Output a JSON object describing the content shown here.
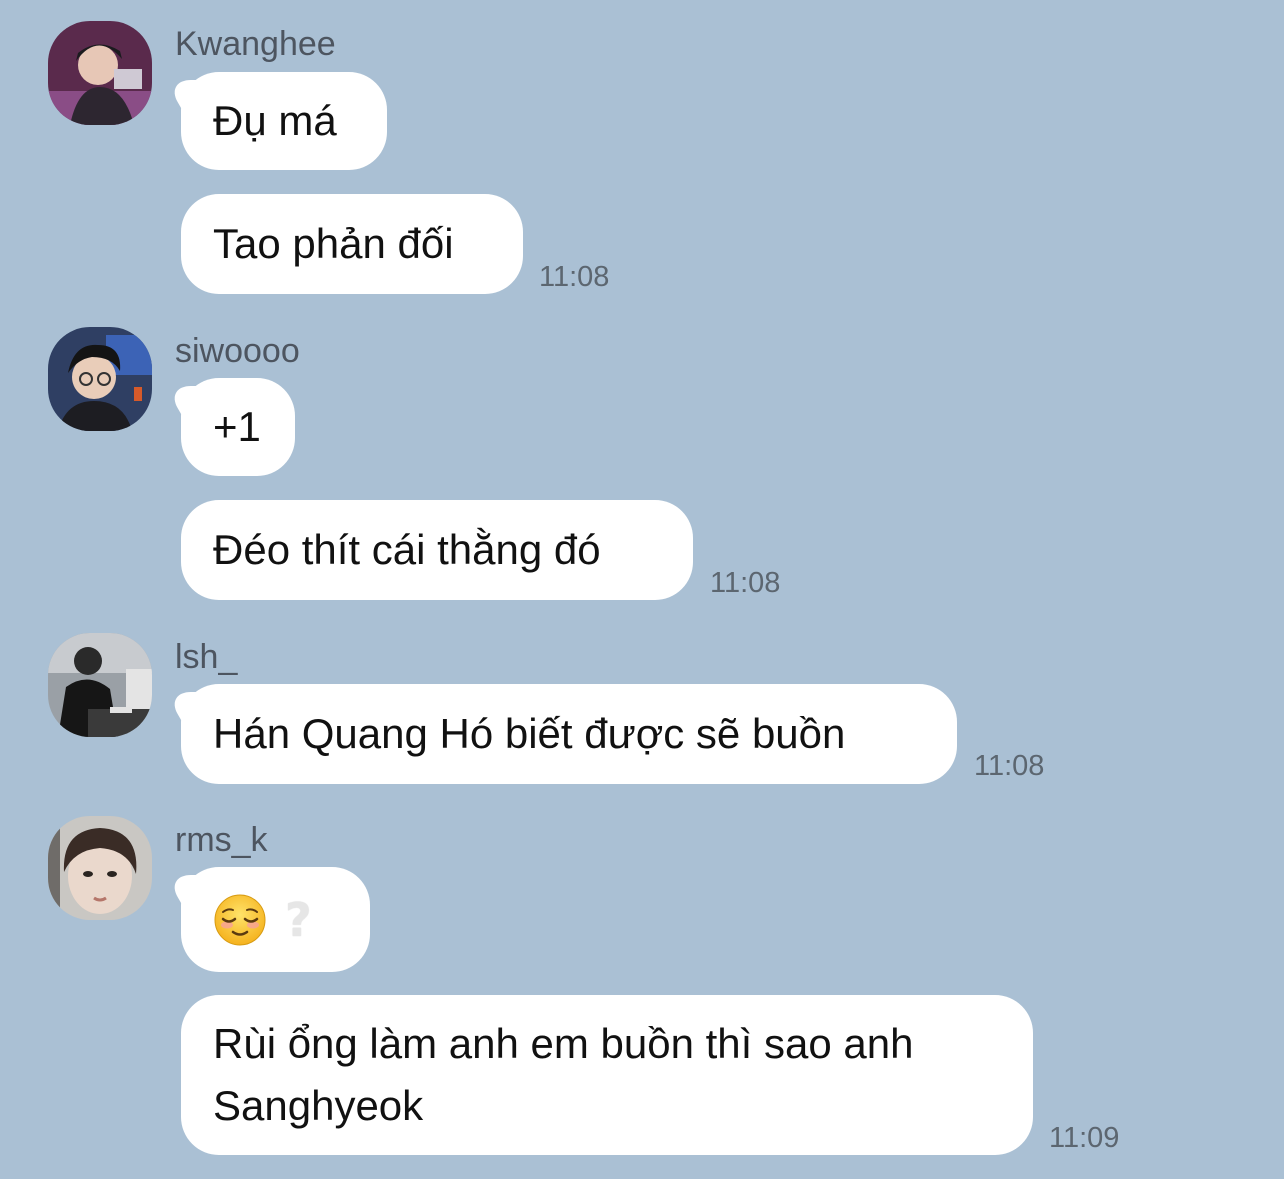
{
  "messages": [
    {
      "sender": "Kwanghee",
      "avatar_icon": "user-avatar-kwanghee",
      "bubbles": [
        "Đụ má",
        "Tao phản đối"
      ],
      "time": "11:08"
    },
    {
      "sender": "siwoooo",
      "avatar_icon": "user-avatar-siwoooo",
      "bubbles": [
        "+1",
        "Đéo thít cái thằng đó"
      ],
      "time": "11:08"
    },
    {
      "sender": "lsh_",
      "avatar_icon": "user-avatar-lsh",
      "bubbles": [
        "Hán Quang Hó biết được sẽ buồn"
      ],
      "time": "11:08"
    },
    {
      "sender": "rms_k",
      "avatar_icon": "user-avatar-rms-k",
      "bubbles": [
        "😌 ?",
        "Rùi ổng làm anh em buồn thì sao anh",
        "Sanghyeok"
      ],
      "time": "11:09"
    }
  ],
  "colors": {
    "background": "#aac0d4",
    "bubble": "#ffffff",
    "sender_text": "#4d5560",
    "time_text": "#5c6670"
  }
}
